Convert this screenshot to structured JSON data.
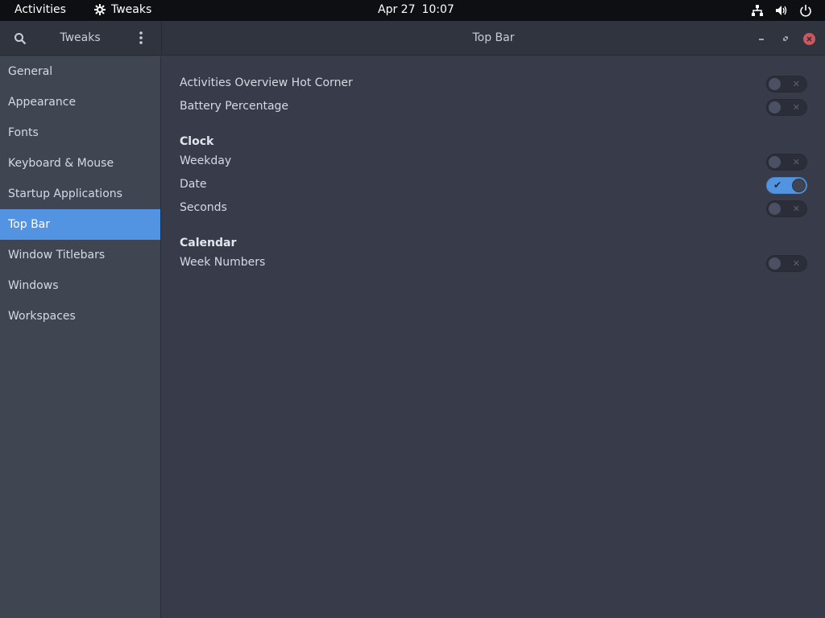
{
  "topbar": {
    "activities": "Activities",
    "app_name": "Tweaks",
    "date": "Apr 27",
    "time": "10:07",
    "tray_icons": [
      "network-icon",
      "volume-icon",
      "power-icon"
    ]
  },
  "headerbar": {
    "sidebar_title": "Tweaks",
    "title": "Top Bar"
  },
  "sidebar": {
    "items": [
      {
        "label": "General"
      },
      {
        "label": "Appearance"
      },
      {
        "label": "Fonts"
      },
      {
        "label": "Keyboard & Mouse"
      },
      {
        "label": "Startup Applications"
      },
      {
        "label": "Top Bar",
        "selected": true
      },
      {
        "label": "Window Titlebars"
      },
      {
        "label": "Windows"
      },
      {
        "label": "Workspaces"
      }
    ]
  },
  "content": {
    "general_rows": [
      {
        "label": "Activities Overview Hot Corner",
        "on": false
      },
      {
        "label": "Battery Percentage",
        "on": false
      }
    ],
    "clock": {
      "title": "Clock",
      "rows": [
        {
          "label": "Weekday",
          "on": false
        },
        {
          "label": "Date",
          "on": true
        },
        {
          "label": "Seconds",
          "on": false
        }
      ]
    },
    "calendar": {
      "title": "Calendar",
      "rows": [
        {
          "label": "Week Numbers",
          "on": false
        }
      ]
    }
  },
  "colors": {
    "accent": "#5294e2",
    "close_button": "#cc575d",
    "background": "#383c4a",
    "sidebar": "#404552"
  }
}
